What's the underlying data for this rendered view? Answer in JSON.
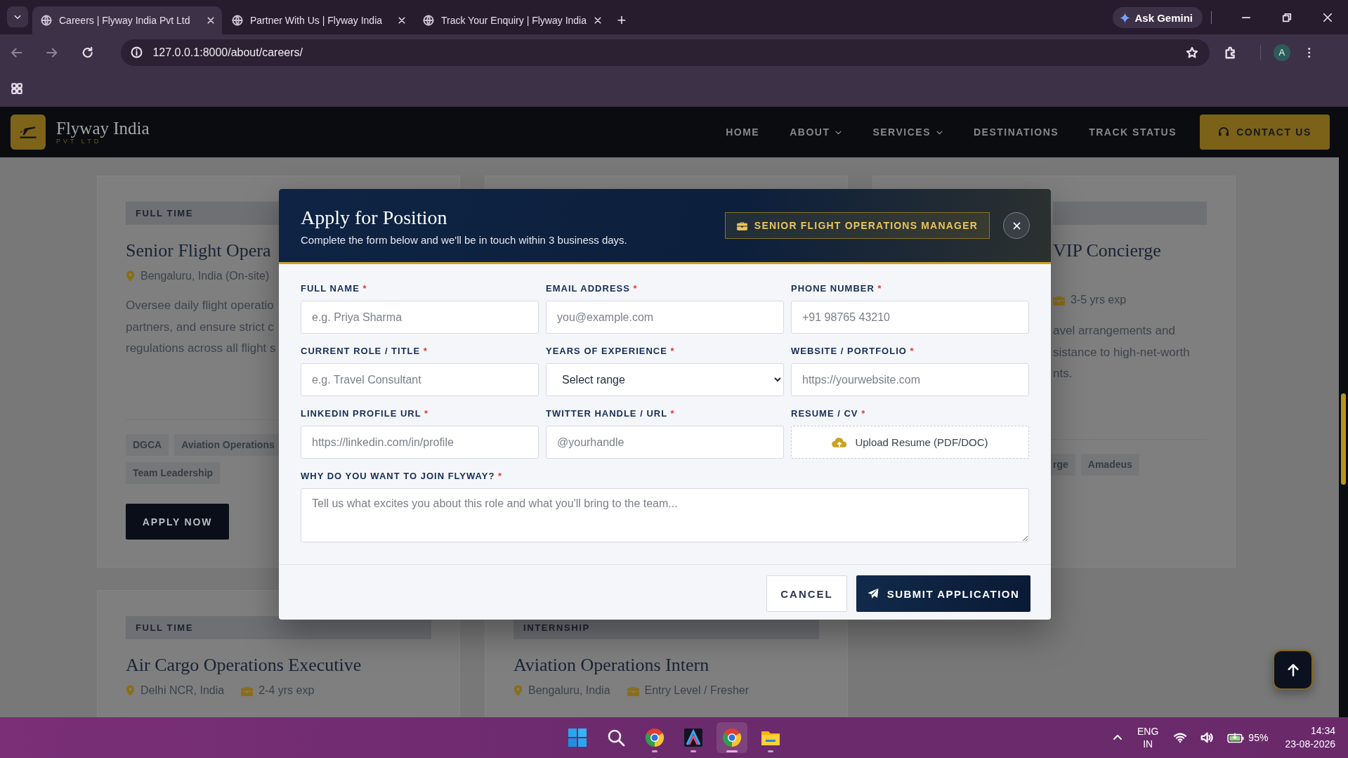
{
  "browser": {
    "tabs": [
      {
        "title": "Careers | Flyway India Pvt Ltd",
        "selected": true
      },
      {
        "title": "Partner With Us | Flyway India",
        "selected": false
      },
      {
        "title": "Track Your Enquiry | Flyway India",
        "selected": false
      }
    ],
    "new_tab": "+",
    "gemini": "Ask Gemini",
    "url": "127.0.0.1:8000/about/careers/",
    "profile": "A"
  },
  "site": {
    "brand": "Flyway India",
    "brand_sub": "PVT LTD",
    "nav": [
      {
        "label": "HOME",
        "dropdown": false
      },
      {
        "label": "ABOUT",
        "dropdown": true
      },
      {
        "label": "SERVICES",
        "dropdown": true
      },
      {
        "label": "DESTINATIONS",
        "dropdown": false
      },
      {
        "label": "TRACK STATUS",
        "dropdown": false
      }
    ],
    "contact": "CONTACT US"
  },
  "cards": [
    {
      "kind": "clipped-right",
      "tag": "FULL TIME",
      "title": "Senior Flight Opera",
      "meta": [
        {
          "kind": "location",
          "text": "Bengaluru, India (On-site)"
        }
      ],
      "description": [
        "Oversee daily flight operatio",
        "partners, and ensure strict c",
        "regulations across all flight s"
      ],
      "skills": [
        "DGCA",
        "Aviation Operations",
        "Team Leadership"
      ],
      "button": "APPLY NOW"
    },
    {
      "kind": "covered"
    },
    {
      "kind": "clipped-left",
      "title": "VIP Concierge",
      "meta": [
        {
          "kind": "experience",
          "text": "3-5 yrs exp"
        }
      ],
      "description": [
        "avel arrangements and",
        "sistance to high-net-worth",
        "nts."
      ],
      "skills": [
        "rge",
        "Amadeus"
      ]
    },
    {
      "kind": "plain",
      "tag": "FULL TIME",
      "title": "Air Cargo Operations Executive",
      "meta": [
        {
          "kind": "location",
          "text": "Delhi NCR, India"
        },
        {
          "kind": "experience",
          "text": "2-4 yrs exp"
        }
      ]
    },
    {
      "kind": "plain",
      "tag": "INTERNSHIP",
      "title": "Aviation Operations Intern",
      "meta": [
        {
          "kind": "location",
          "text": "Bengaluru, India"
        },
        {
          "kind": "experience",
          "text": "Entry Level / Fresher"
        }
      ]
    }
  ],
  "modal": {
    "title": "Apply for Position",
    "subtitle": "Complete the form below and we'll be in touch within 3 business days.",
    "position": "SENIOR FLIGHT OPERATIONS MANAGER",
    "fields": [
      {
        "kind": "text",
        "label": "FULL NAME",
        "mark": "*",
        "placeholder": "e.g. Priya Sharma"
      },
      {
        "kind": "text",
        "label": "EMAIL ADDRESS",
        "mark": "*",
        "placeholder": "you@example.com"
      },
      {
        "kind": "text",
        "label": "PHONE NUMBER",
        "mark": "*",
        "placeholder": "+91 98765 43210"
      },
      {
        "kind": "text",
        "label": "CURRENT ROLE / TITLE",
        "mark": "*",
        "placeholder": "e.g. Travel Consultant"
      },
      {
        "kind": "select",
        "label": "YEARS OF EXPERIENCE",
        "mark": "*",
        "value": "Select range"
      },
      {
        "kind": "text",
        "label": "WEBSITE / PORTFOLIO",
        "mark": "*",
        "placeholder": "https://yourwebsite.com"
      },
      {
        "kind": "text",
        "label": "LINKEDIN PROFILE URL",
        "mark": "*",
        "placeholder": "https://linkedin.com/in/profile"
      },
      {
        "kind": "text",
        "label": "TWITTER HANDLE / URL",
        "mark": "*",
        "placeholder": "@yourhandle"
      },
      {
        "kind": "upload",
        "label": "RESUME / CV",
        "mark": "*",
        "button": "Upload Resume (PDF/DOC)"
      },
      {
        "kind": "textarea",
        "label": "WHY DO YOU WANT TO JOIN FLYWAY?",
        "mark": "*",
        "placeholder": "Tell us what excites you about this role and what you'll bring to the team..."
      }
    ],
    "cancel": "CANCEL",
    "submit": "SUBMIT APPLICATION"
  },
  "taskbar": {
    "apps": [
      {
        "kind": "start",
        "running": false,
        "selected": false
      },
      {
        "kind": "search",
        "running": false,
        "selected": false
      },
      {
        "kind": "browser",
        "running": true,
        "selected": false
      },
      {
        "kind": "app",
        "running": true,
        "selected": false
      },
      {
        "kind": "browser",
        "running": true,
        "selected": true
      },
      {
        "kind": "folder",
        "running": true,
        "selected": false
      }
    ],
    "lang": "ENG",
    "region": "IN",
    "battery": "95%",
    "time": "14:34",
    "date": "23-08-2026"
  }
}
